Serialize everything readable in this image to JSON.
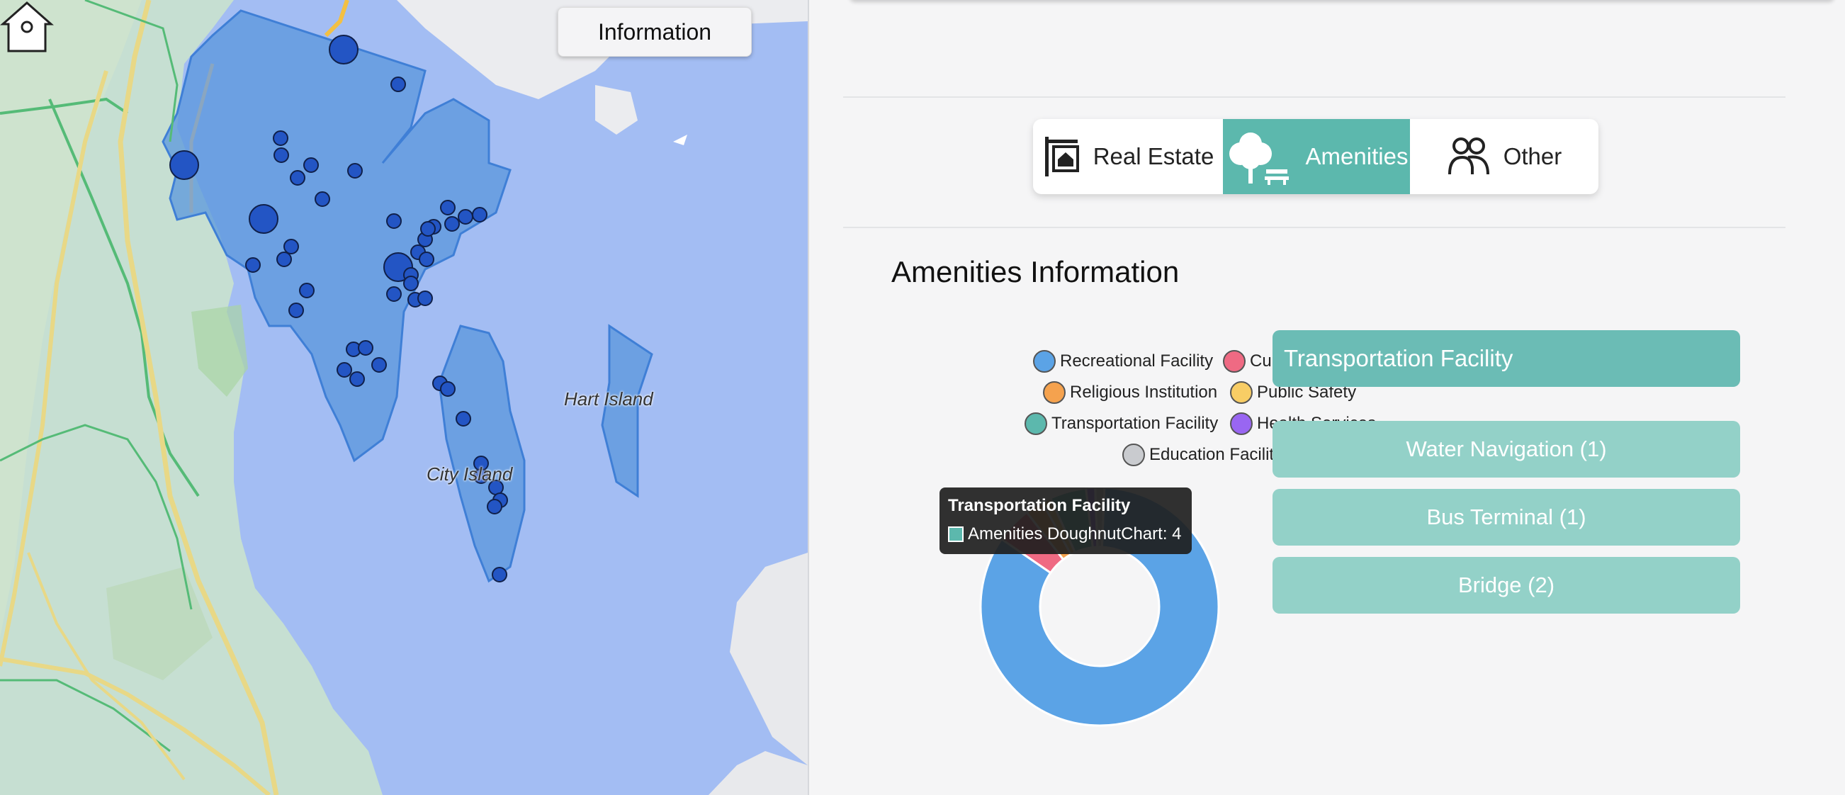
{
  "map": {
    "info_button": "Information",
    "places": [
      {
        "name": "Hart Island"
      },
      {
        "name": "City Island"
      }
    ]
  },
  "tabs": [
    {
      "label": "Real Estate",
      "icon": "real-estate-sign-icon"
    },
    {
      "label": "Amenities",
      "icon": "tree-bench-icon",
      "active": true
    },
    {
      "label": "Other",
      "icon": "people-icon"
    }
  ],
  "section_title": "Amenities Information",
  "legend": [
    {
      "label": "Recreational Facility",
      "color": "#5ba3e6"
    },
    {
      "label": "Cultural Facility",
      "color": "#ef6a83"
    },
    {
      "label": "Religious Institution",
      "color": "#f5a24e"
    },
    {
      "label": "Public Safety",
      "color": "#f8cd65"
    },
    {
      "label": "Transportation Facility",
      "color": "#5cb8ad"
    },
    {
      "label": "Health Services",
      "color": "#9966f2"
    },
    {
      "label": "Education Facility",
      "color": "#c9cbcf"
    }
  ],
  "chart_data": {
    "type": "pie",
    "categories": [
      "Recreational Facility",
      "Cultural Facility",
      "Religious Institution",
      "Public Safety",
      "Transportation Facility",
      "Health Services",
      "Education Facility"
    ],
    "values": [
      68,
      4,
      2,
      1,
      4,
      1,
      1
    ],
    "colors": [
      "#5ba3e6",
      "#ef6a83",
      "#f5a24e",
      "#f8cd65",
      "#5cb8ad",
      "#9966f2",
      "#c9cbcf"
    ],
    "donut": true
  },
  "tooltip": {
    "title": "Transportation Facility",
    "body": "Amenities DoughnutChart: 4"
  },
  "selected_facility": {
    "title": "Transportation Facility",
    "items": [
      {
        "label": "Water Navigation (1)"
      },
      {
        "label": "Bus Terminal (1)"
      },
      {
        "label": "Bridge (2)"
      }
    ]
  }
}
